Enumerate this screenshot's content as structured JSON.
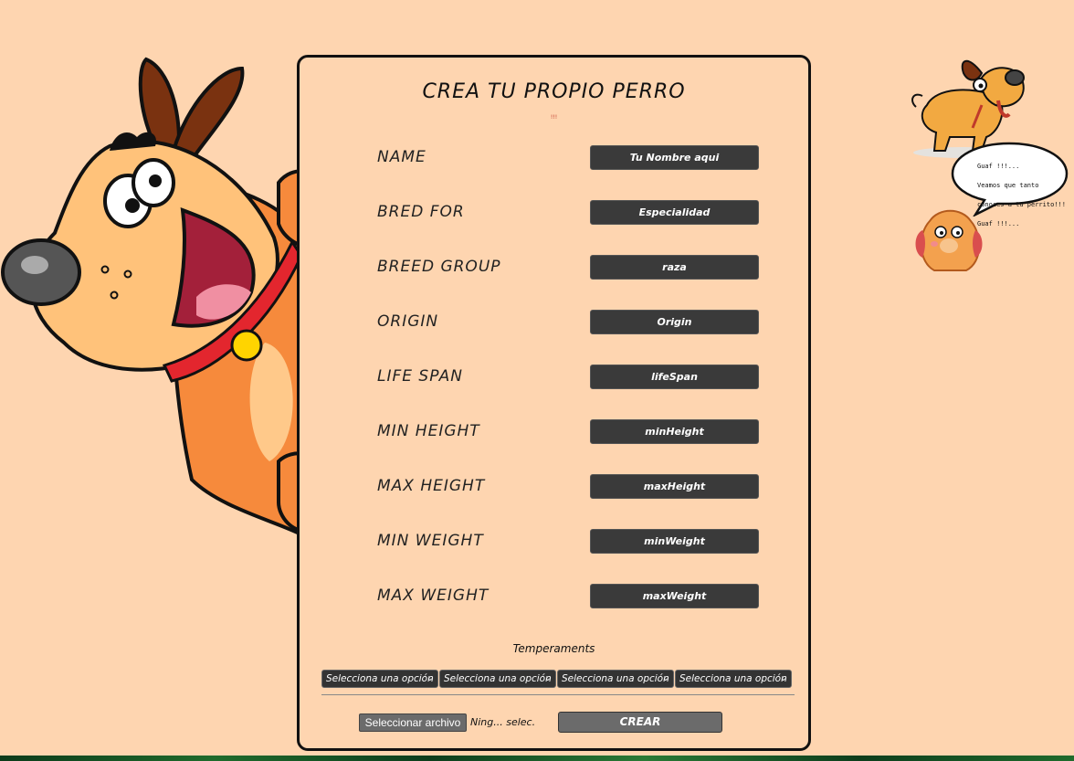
{
  "form": {
    "title": "CREA TU PROPIO PERRO",
    "error": "!!!",
    "fields": [
      {
        "label": "NAME",
        "placeholder": "Tu Nombre aqui"
      },
      {
        "label": "BRED FOR",
        "placeholder": "Especialidad"
      },
      {
        "label": "BREED GROUP",
        "placeholder": "raza"
      },
      {
        "label": "ORIGIN",
        "placeholder": "Origin"
      },
      {
        "label": "LIFE SPAN",
        "placeholder": "lifeSpan"
      },
      {
        "label": "MIN HEIGHT",
        "placeholder": "minHeight"
      },
      {
        "label": "MAX HEIGHT",
        "placeholder": "maxHeight"
      },
      {
        "label": "MIN WEIGHT",
        "placeholder": "minWeight"
      },
      {
        "label": "MAX WEIGHT",
        "placeholder": "maxWeight"
      }
    ],
    "temperaments_label": "Temperaments",
    "temperament_selects": [
      "Selecciona una opción",
      "Selecciona una opción",
      "Selecciona una opción",
      "Selecciona una opción"
    ],
    "file_button": "Seleccionar archivo",
    "file_name": "Ning... selec.",
    "submit": "CREAR"
  },
  "speech_bubble": {
    "lines": [
      "Guaf !!!...",
      "Veamos que tanto",
      "conoces a tu perrito!!!",
      "Guaf !!!..."
    ]
  },
  "icons": {
    "big_dog": "cartoon-dog-peeking-icon",
    "small_dog": "cartoon-dog-walking-icon",
    "puppy": "cartoon-puppy-icon",
    "bubble": "speech-bubble-icon"
  },
  "colors": {
    "background": "#fed5b0",
    "input_bg": "#3a3a3a",
    "button_bg": "#6b6b6b"
  }
}
